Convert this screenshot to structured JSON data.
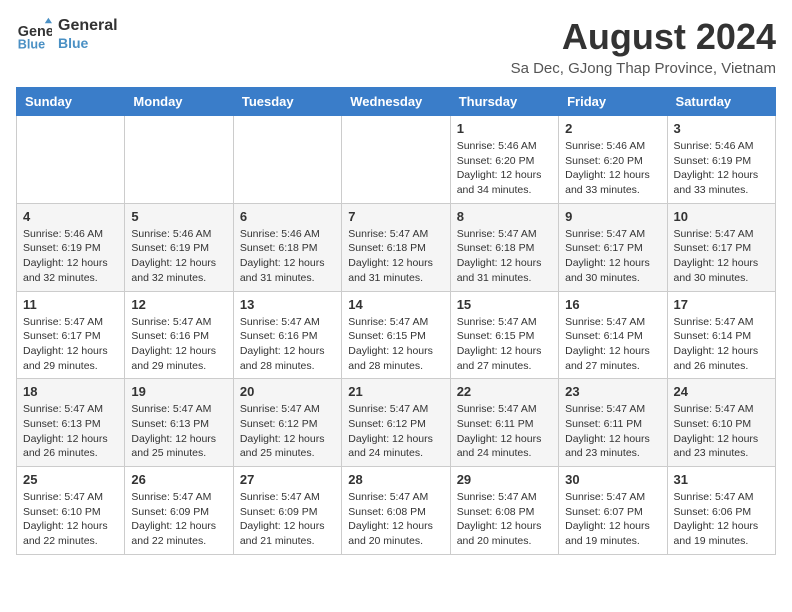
{
  "header": {
    "logo_line1": "General",
    "logo_line2": "Blue",
    "month_year": "August 2024",
    "location": "Sa Dec, GJong Thap Province, Vietnam"
  },
  "days_of_week": [
    "Sunday",
    "Monday",
    "Tuesday",
    "Wednesday",
    "Thursday",
    "Friday",
    "Saturday"
  ],
  "weeks": [
    [
      {
        "day": "",
        "info": ""
      },
      {
        "day": "",
        "info": ""
      },
      {
        "day": "",
        "info": ""
      },
      {
        "day": "",
        "info": ""
      },
      {
        "day": "1",
        "info": "Sunrise: 5:46 AM\nSunset: 6:20 PM\nDaylight: 12 hours and 34 minutes."
      },
      {
        "day": "2",
        "info": "Sunrise: 5:46 AM\nSunset: 6:20 PM\nDaylight: 12 hours and 33 minutes."
      },
      {
        "day": "3",
        "info": "Sunrise: 5:46 AM\nSunset: 6:19 PM\nDaylight: 12 hours and 33 minutes."
      }
    ],
    [
      {
        "day": "4",
        "info": "Sunrise: 5:46 AM\nSunset: 6:19 PM\nDaylight: 12 hours and 32 minutes."
      },
      {
        "day": "5",
        "info": "Sunrise: 5:46 AM\nSunset: 6:19 PM\nDaylight: 12 hours and 32 minutes."
      },
      {
        "day": "6",
        "info": "Sunrise: 5:46 AM\nSunset: 6:18 PM\nDaylight: 12 hours and 31 minutes."
      },
      {
        "day": "7",
        "info": "Sunrise: 5:47 AM\nSunset: 6:18 PM\nDaylight: 12 hours and 31 minutes."
      },
      {
        "day": "8",
        "info": "Sunrise: 5:47 AM\nSunset: 6:18 PM\nDaylight: 12 hours and 31 minutes."
      },
      {
        "day": "9",
        "info": "Sunrise: 5:47 AM\nSunset: 6:17 PM\nDaylight: 12 hours and 30 minutes."
      },
      {
        "day": "10",
        "info": "Sunrise: 5:47 AM\nSunset: 6:17 PM\nDaylight: 12 hours and 30 minutes."
      }
    ],
    [
      {
        "day": "11",
        "info": "Sunrise: 5:47 AM\nSunset: 6:17 PM\nDaylight: 12 hours and 29 minutes."
      },
      {
        "day": "12",
        "info": "Sunrise: 5:47 AM\nSunset: 6:16 PM\nDaylight: 12 hours and 29 minutes."
      },
      {
        "day": "13",
        "info": "Sunrise: 5:47 AM\nSunset: 6:16 PM\nDaylight: 12 hours and 28 minutes."
      },
      {
        "day": "14",
        "info": "Sunrise: 5:47 AM\nSunset: 6:15 PM\nDaylight: 12 hours and 28 minutes."
      },
      {
        "day": "15",
        "info": "Sunrise: 5:47 AM\nSunset: 6:15 PM\nDaylight: 12 hours and 27 minutes."
      },
      {
        "day": "16",
        "info": "Sunrise: 5:47 AM\nSunset: 6:14 PM\nDaylight: 12 hours and 27 minutes."
      },
      {
        "day": "17",
        "info": "Sunrise: 5:47 AM\nSunset: 6:14 PM\nDaylight: 12 hours and 26 minutes."
      }
    ],
    [
      {
        "day": "18",
        "info": "Sunrise: 5:47 AM\nSunset: 6:13 PM\nDaylight: 12 hours and 26 minutes."
      },
      {
        "day": "19",
        "info": "Sunrise: 5:47 AM\nSunset: 6:13 PM\nDaylight: 12 hours and 25 minutes."
      },
      {
        "day": "20",
        "info": "Sunrise: 5:47 AM\nSunset: 6:12 PM\nDaylight: 12 hours and 25 minutes."
      },
      {
        "day": "21",
        "info": "Sunrise: 5:47 AM\nSunset: 6:12 PM\nDaylight: 12 hours and 24 minutes."
      },
      {
        "day": "22",
        "info": "Sunrise: 5:47 AM\nSunset: 6:11 PM\nDaylight: 12 hours and 24 minutes."
      },
      {
        "day": "23",
        "info": "Sunrise: 5:47 AM\nSunset: 6:11 PM\nDaylight: 12 hours and 23 minutes."
      },
      {
        "day": "24",
        "info": "Sunrise: 5:47 AM\nSunset: 6:10 PM\nDaylight: 12 hours and 23 minutes."
      }
    ],
    [
      {
        "day": "25",
        "info": "Sunrise: 5:47 AM\nSunset: 6:10 PM\nDaylight: 12 hours and 22 minutes."
      },
      {
        "day": "26",
        "info": "Sunrise: 5:47 AM\nSunset: 6:09 PM\nDaylight: 12 hours and 22 minutes."
      },
      {
        "day": "27",
        "info": "Sunrise: 5:47 AM\nSunset: 6:09 PM\nDaylight: 12 hours and 21 minutes."
      },
      {
        "day": "28",
        "info": "Sunrise: 5:47 AM\nSunset: 6:08 PM\nDaylight: 12 hours and 20 minutes."
      },
      {
        "day": "29",
        "info": "Sunrise: 5:47 AM\nSunset: 6:08 PM\nDaylight: 12 hours and 20 minutes."
      },
      {
        "day": "30",
        "info": "Sunrise: 5:47 AM\nSunset: 6:07 PM\nDaylight: 12 hours and 19 minutes."
      },
      {
        "day": "31",
        "info": "Sunrise: 5:47 AM\nSunset: 6:06 PM\nDaylight: 12 hours and 19 minutes."
      }
    ]
  ]
}
